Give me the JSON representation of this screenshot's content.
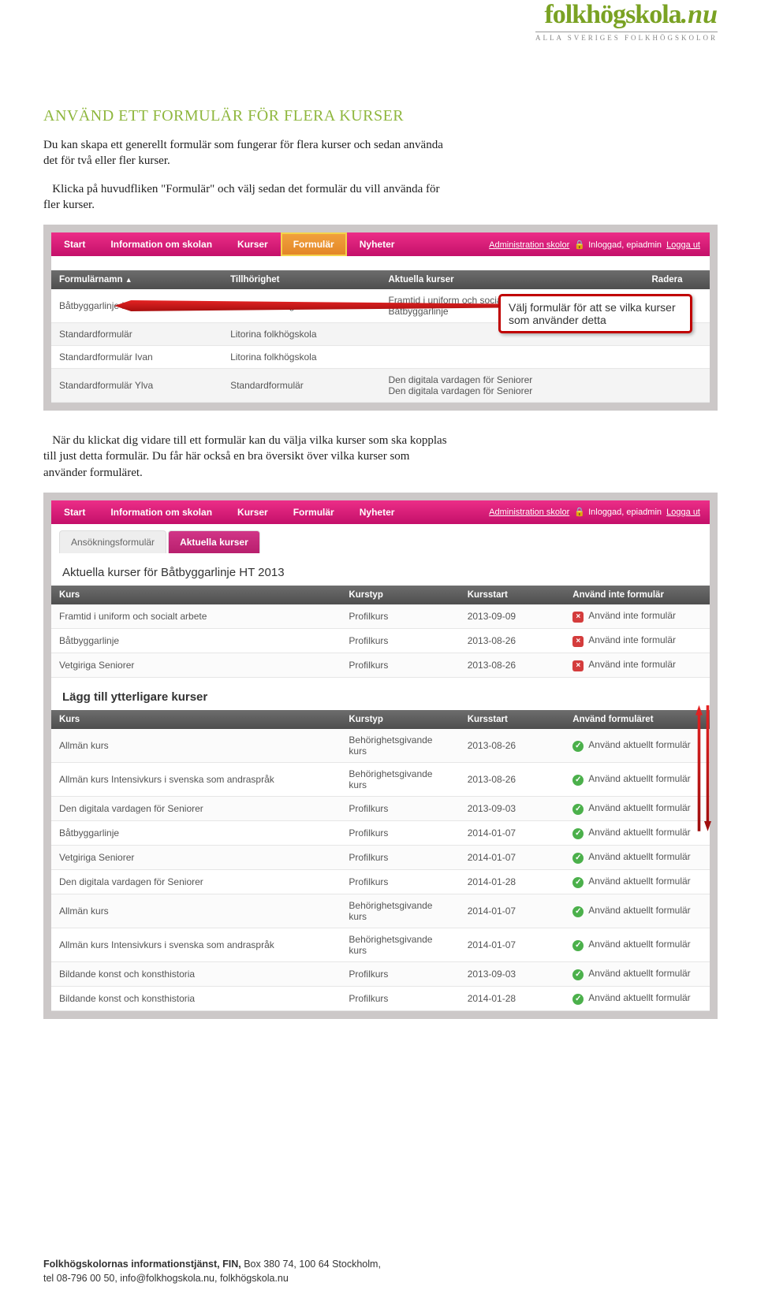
{
  "logo": {
    "word1": "folkhögskola",
    "word2": ".nu",
    "sub": "ALLA SVERIGES FOLKHÖGSKOLOR"
  },
  "heading1": "ANVÄND ETT FORMULÄR FÖR FLERA KURSER",
  "para1_l1": "Du kan skapa ett generellt formulär som fungerar för flera kurser och sedan använda det för två eller fler kurser.",
  "para1_l2": "   Klicka på huvudfliken \"Formulär\" och välj sedan det formulär du vill använda för fler kurser.",
  "nav": {
    "items": [
      "Start",
      "Information om skolan",
      "Kurser",
      "Formulär",
      "Nyheter"
    ],
    "admin_link": "Administration skolor",
    "logged_in": "Inloggad, epiadmin",
    "logout": "Logga ut"
  },
  "shot1": {
    "cols": [
      "Formulärnamn",
      "Tillhörighet",
      "Aktuella kurser",
      "Radera"
    ],
    "rows": [
      {
        "name": "Båtbyggarlinje HT 2013",
        "own": "Litorina folkhögskola",
        "courses": [
          "Framtid i uniform och socialt arbete",
          "Båtbyggarlinje"
        ]
      },
      {
        "name": "Standardformulär",
        "own": "Litorina folkhögskola",
        "courses": []
      },
      {
        "name": "Standardformulär Ivan",
        "own": "Litorina folkhögskola",
        "courses": []
      },
      {
        "name": "Standardformulär Ylva",
        "own": "Standardformulär",
        "courses": [
          "Den digitala vardagen för Seniorer",
          "Den digitala vardagen för Seniorer"
        ]
      }
    ],
    "callout": "Välj formulär för att se vilka kurser som använder detta"
  },
  "para2_l1": "   När du klickat dig vidare till ett formulär kan du välja vilka kurser som ska kopplas till just detta formulär. Du får här också en bra översikt över vilka kurser som använder formuläret.",
  "shot2": {
    "subtabs": [
      "Ansökningsformulär",
      "Aktuella kurser"
    ],
    "title": "Aktuella kurser för Båtbyggarlinje HT 2013",
    "table1": {
      "cols": [
        "Kurs",
        "Kurstyp",
        "Kursstart",
        "Använd inte formulär"
      ],
      "rows": [
        [
          "Framtid i uniform och socialt arbete",
          "Profilkurs",
          "2013-09-09",
          "Använd inte formulär"
        ],
        [
          "Båtbyggarlinje",
          "Profilkurs",
          "2013-08-26",
          "Använd inte formulär"
        ],
        [
          "Vetgiriga Seniorer",
          "Profilkurs",
          "2013-08-26",
          "Använd inte formulär"
        ]
      ]
    },
    "subtitle2": "Lägg till ytterligare kurser",
    "table2": {
      "cols": [
        "Kurs",
        "Kurstyp",
        "Kursstart",
        "Använd formuläret"
      ],
      "rows": [
        [
          "Allmän kurs",
          "Behörighetsgivande kurs",
          "2013-08-26",
          "Använd aktuellt formulär"
        ],
        [
          "Allmän kurs Intensivkurs i svenska som andraspråk",
          "Behörighetsgivande kurs",
          "2013-08-26",
          "Använd aktuellt formulär"
        ],
        [
          "Den digitala vardagen för Seniorer",
          "Profilkurs",
          "2013-09-03",
          "Använd aktuellt formulär"
        ],
        [
          "Båtbyggarlinje",
          "Profilkurs",
          "2014-01-07",
          "Använd aktuellt formulär"
        ],
        [
          "Vetgiriga Seniorer",
          "Profilkurs",
          "2014-01-07",
          "Använd aktuellt formulär"
        ],
        [
          "Den digitala vardagen för Seniorer",
          "Profilkurs",
          "2014-01-28",
          "Använd aktuellt formulär"
        ],
        [
          "Allmän kurs",
          "Behörighetsgivande kurs",
          "2014-01-07",
          "Använd aktuellt formulär"
        ],
        [
          "Allmän kurs Intensivkurs i svenska som andraspråk",
          "Behörighetsgivande kurs",
          "2014-01-07",
          "Använd aktuellt formulär"
        ],
        [
          "Bildande konst och konsthistoria",
          "Profilkurs",
          "2013-09-03",
          "Använd aktuellt formulär"
        ],
        [
          "Bildande konst och konsthistoria",
          "Profilkurs",
          "2014-01-28",
          "Använd aktuellt formulär"
        ]
      ]
    }
  },
  "footer": {
    "l1a": "Folkhögskolornas informationstjänst, FIN,",
    "l1b": " Box 380 74, 100 64 Stockholm,",
    "l2": "tel 08-796 00 50, info@folkhogskola.nu, folkhögskola.nu"
  }
}
